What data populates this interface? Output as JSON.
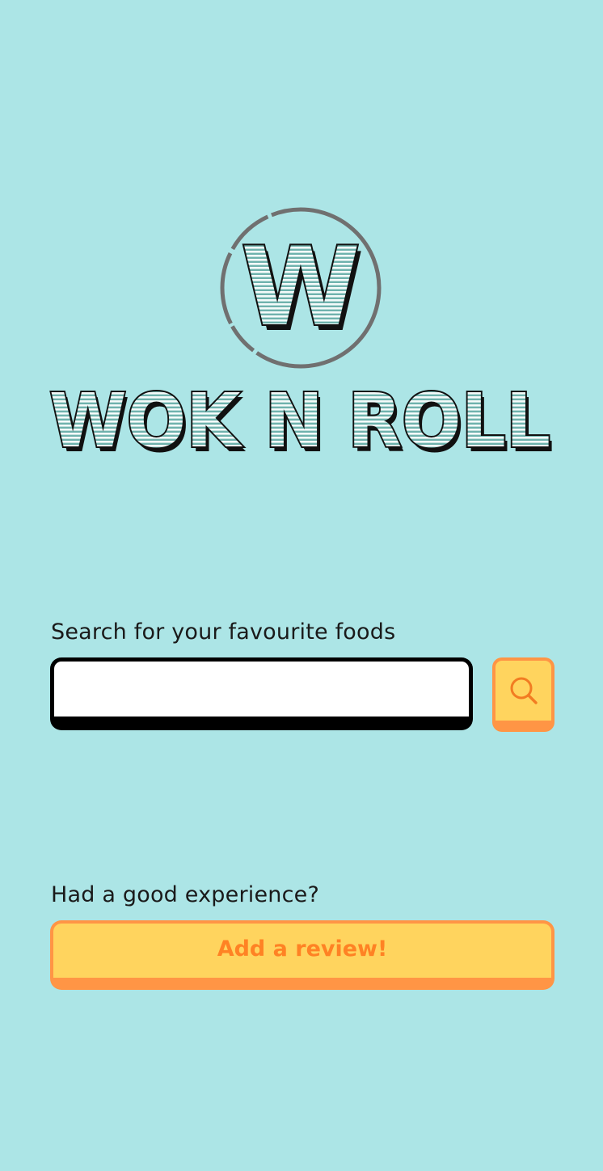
{
  "brand": {
    "logo_letter": "W",
    "logo_text": "WOK N ROLL"
  },
  "search": {
    "label": "Search for your favourite foods",
    "value": "",
    "placeholder": "",
    "button_icon": "search-icon"
  },
  "review": {
    "label": "Had a good experience?",
    "button_label": "Add a review!"
  },
  "colors": {
    "background": "#ace5e6",
    "button_fill": "#ffd45e",
    "button_border": "#ff9545",
    "button_text": "#ff8224",
    "logo_stripes": "#8fc9c4"
  }
}
